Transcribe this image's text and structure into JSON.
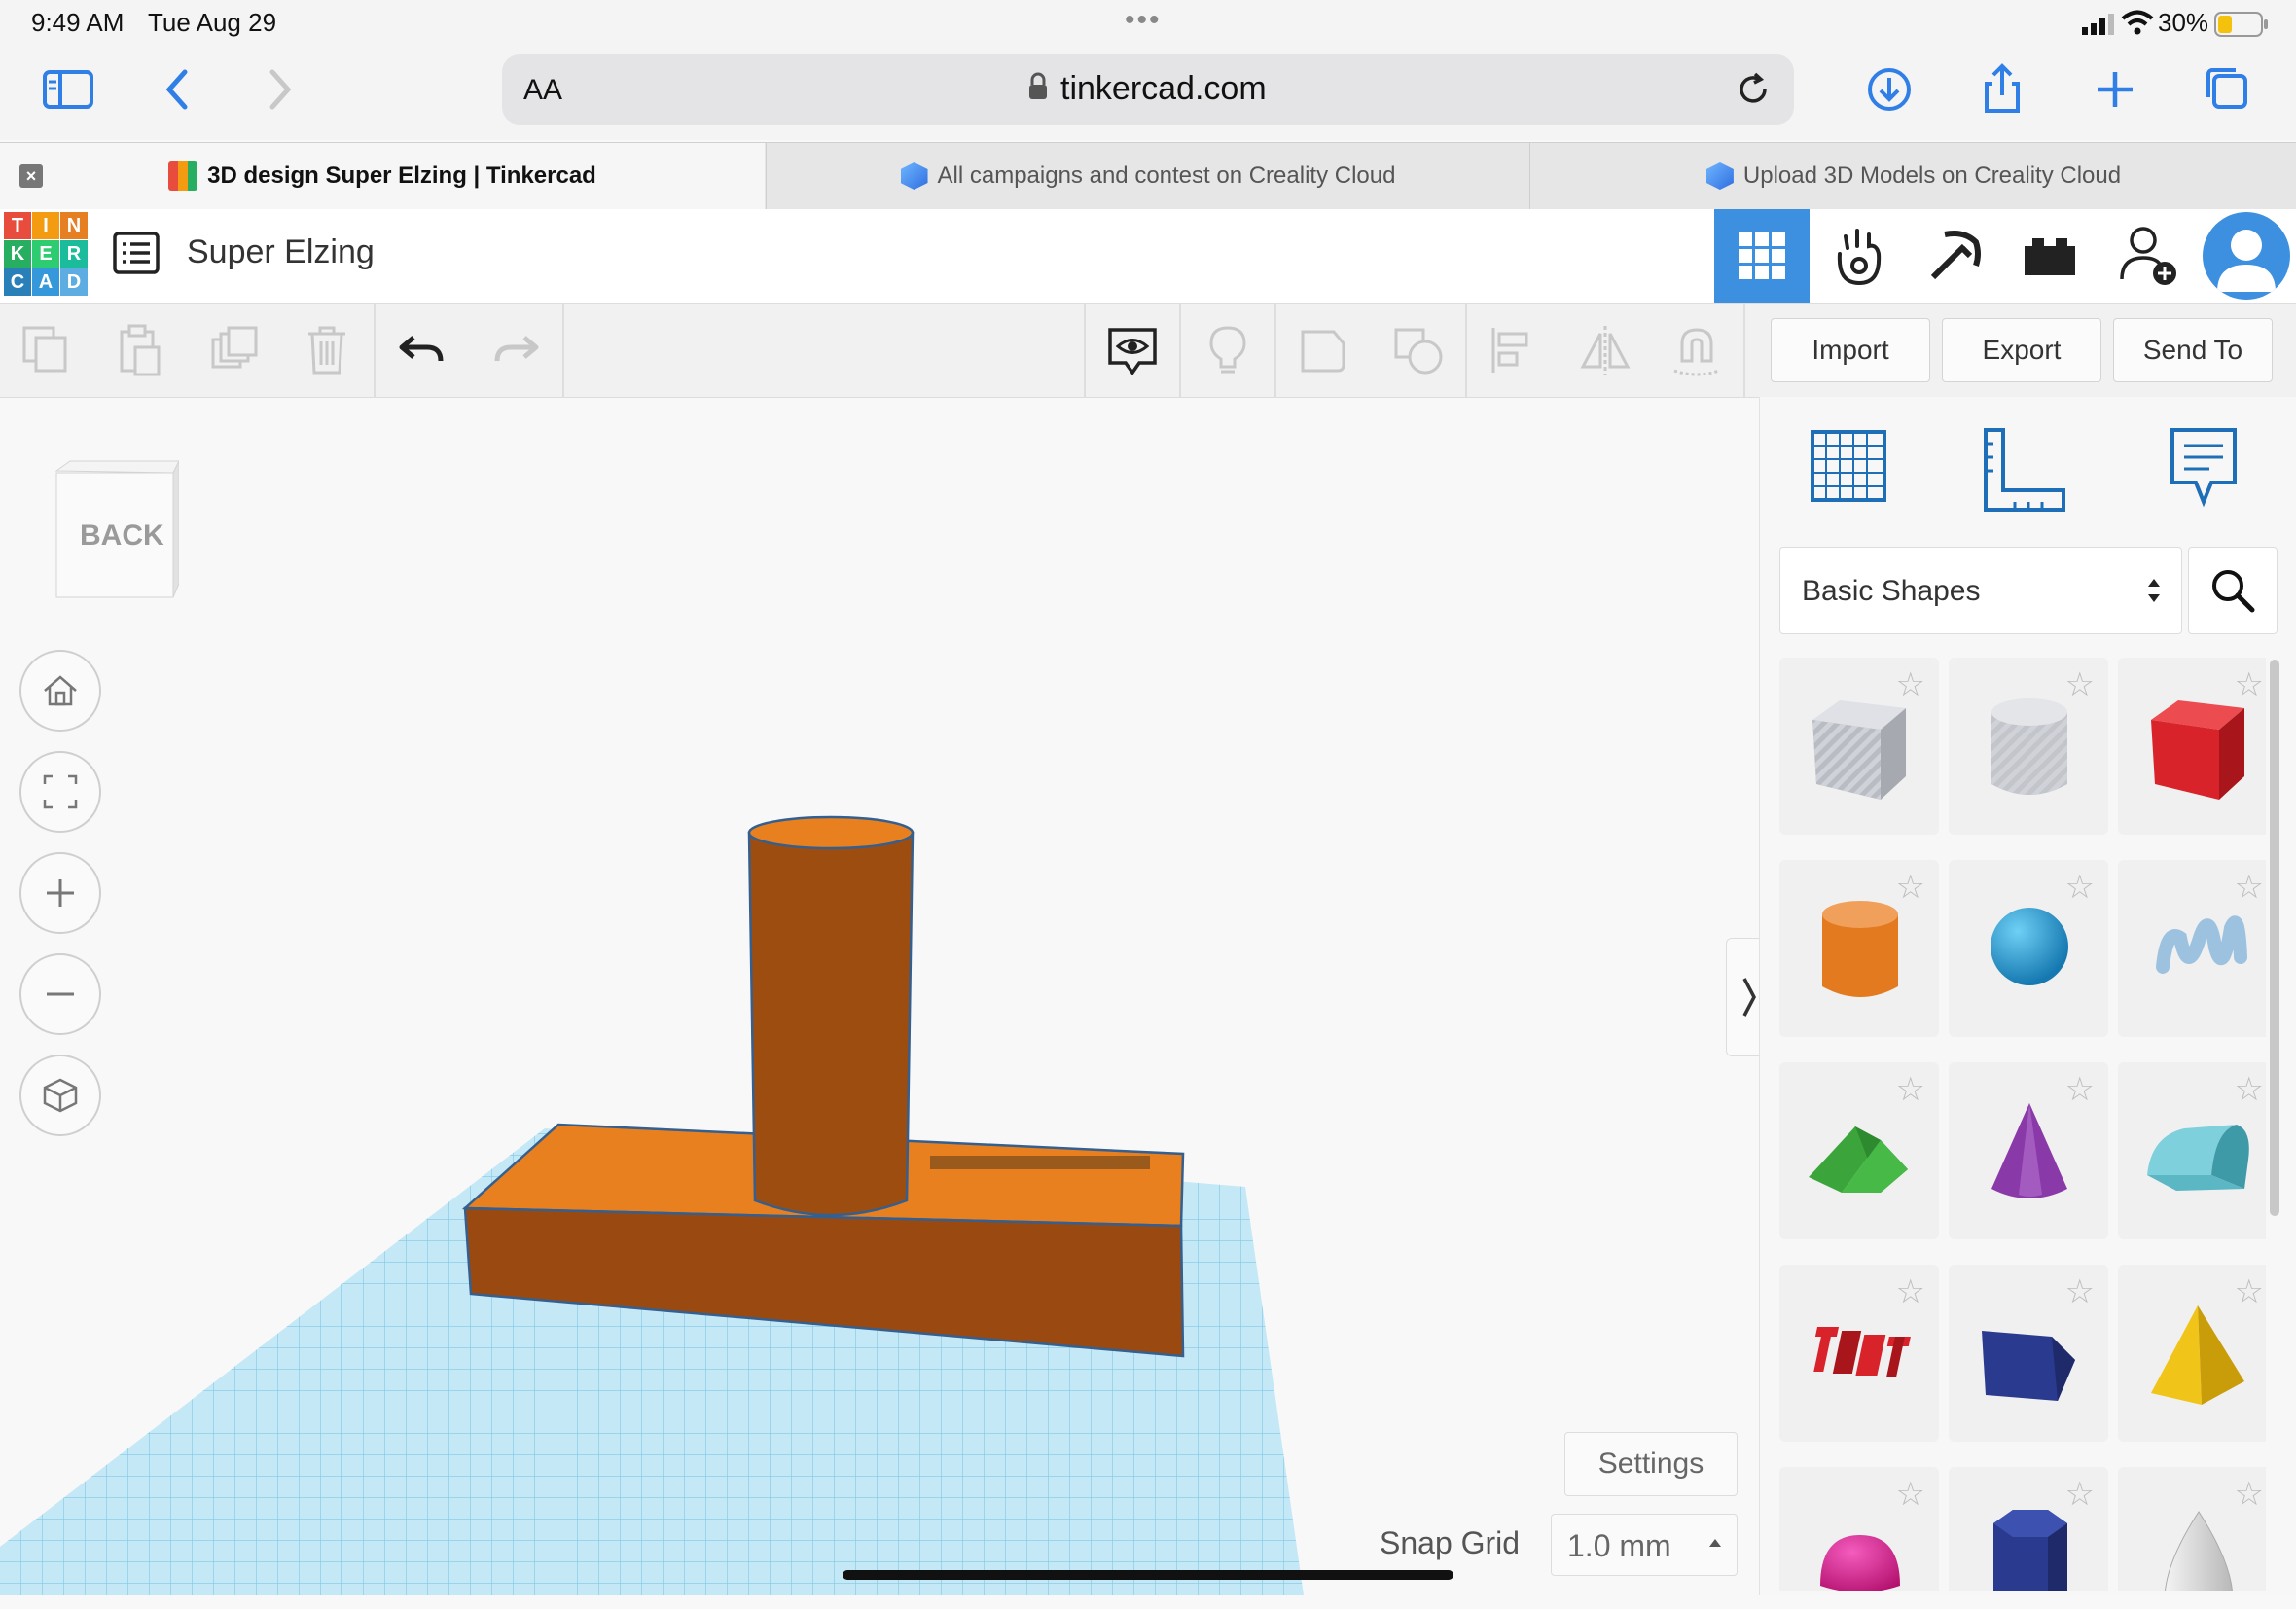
{
  "status": {
    "time": "9:49 AM",
    "date": "Tue Aug 29",
    "battery": "30%"
  },
  "browser": {
    "url_aa": "AA",
    "url": "tinkercad.com",
    "tabs": [
      {
        "label": "3D design Super Elzing | Tinkercad",
        "active": true
      },
      {
        "label": "All campaigns and contest on Creality Cloud",
        "active": false
      },
      {
        "label": "Upload 3D Models on Creality Cloud",
        "active": false
      }
    ]
  },
  "app": {
    "logo_letters": [
      "T",
      "I",
      "N",
      "K",
      "E",
      "R",
      "C",
      "A",
      "D"
    ],
    "design_title": "Super Elzing",
    "buttons": {
      "import": "Import",
      "export": "Export",
      "send_to": "Send To"
    }
  },
  "viewcube": {
    "face": "BACK"
  },
  "library": {
    "category": "Basic Shapes",
    "shapes": [
      {
        "name": "box-hole",
        "color": "#b9bcc2"
      },
      {
        "name": "cylinder-hole",
        "color": "#c3c5ca"
      },
      {
        "name": "box",
        "color": "#d8232a"
      },
      {
        "name": "cylinder",
        "color": "#e37a1f"
      },
      {
        "name": "sphere",
        "color": "#1a9ad6"
      },
      {
        "name": "scribble",
        "color": "#9cc2e0"
      },
      {
        "name": "roof",
        "color": "#3ba53b"
      },
      {
        "name": "cone",
        "color": "#8a3aa8"
      },
      {
        "name": "round-roof",
        "color": "#5cb7c4"
      },
      {
        "name": "text",
        "color": "#d8232a"
      },
      {
        "name": "wedge",
        "color": "#2a3b8f"
      },
      {
        "name": "pyramid",
        "color": "#f0c419"
      },
      {
        "name": "half-sphere",
        "color": "#e0198c"
      },
      {
        "name": "polygon",
        "color": "#2a3b8f"
      },
      {
        "name": "paraboloid",
        "color": "#d8d8d8"
      }
    ]
  },
  "bottom": {
    "settings": "Settings",
    "snap_label": "Snap Grid",
    "snap_value": "1.0 mm"
  },
  "colors": {
    "tinkercad_blue": "#3d8fe0",
    "orange": "#e37a1f",
    "grid": "#a8dcef"
  }
}
